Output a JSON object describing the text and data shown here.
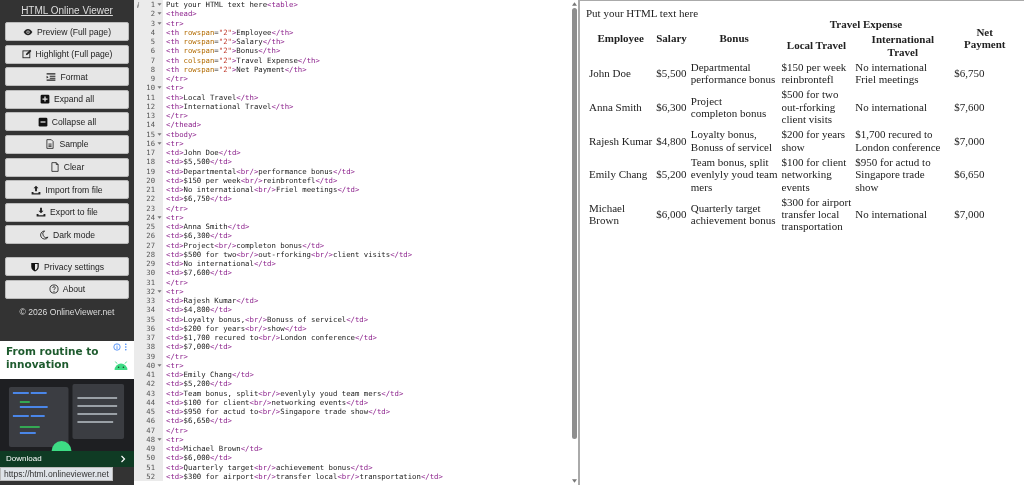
{
  "sidebar": {
    "title": "HTML Online Viewer",
    "tool_buttons": [
      "Preview (Full page)",
      "Highlight (Full page)",
      "Format",
      "Expand all",
      "Collapse all",
      "Sample",
      "Clear",
      "Import from file",
      "Export to file",
      "Dark mode"
    ],
    "settings_buttons": [
      "Privacy settings",
      "About"
    ],
    "copyright": "© 2026 OnlineViewer.net"
  },
  "ad": {
    "headline": "From routine to innovation",
    "cta": "Download"
  },
  "status_url": "https://html.onlineviewer.net",
  "editor": {
    "lines": [
      {
        "num": "1",
        "code": "Put your HTML text here<table>",
        "foldable": true,
        "annotated": true
      },
      {
        "num": "2",
        "code": "<thead>",
        "foldable": true,
        "annotated": false
      },
      {
        "num": "3",
        "code": "<tr>",
        "foldable": true,
        "annotated": false
      },
      {
        "num": "4",
        "code": "<th rowspan=\"2\">Employee</th>",
        "foldable": false,
        "annotated": false
      },
      {
        "num": "5",
        "code": "<th rowspan=\"2\">Salary</th>",
        "foldable": false,
        "annotated": false
      },
      {
        "num": "6",
        "code": "<th rowspan=\"2\">Bonus</th>",
        "foldable": false,
        "annotated": false
      },
      {
        "num": "7",
        "code": "<th colspan=\"2\">Travel Expense</th>",
        "foldable": false,
        "annotated": false
      },
      {
        "num": "8",
        "code": "<th rowspan=\"2\">Net Payment</th>",
        "foldable": false,
        "annotated": false
      },
      {
        "num": "9",
        "code": "</tr>",
        "foldable": false,
        "annotated": false
      },
      {
        "num": "10",
        "code": "<tr>",
        "foldable": true,
        "annotated": false
      },
      {
        "num": "11",
        "code": "<th>Local Travel</th>",
        "foldable": false,
        "annotated": false
      },
      {
        "num": "12",
        "code": "<th>International Travel</th>",
        "foldable": false,
        "annotated": false
      },
      {
        "num": "13",
        "code": "</tr>",
        "foldable": false,
        "annotated": false
      },
      {
        "num": "14",
        "code": "</thead>",
        "foldable": false,
        "annotated": false
      },
      {
        "num": "15",
        "code": "<tbody>",
        "foldable": true,
        "annotated": false
      },
      {
        "num": "16",
        "code": "<tr>",
        "foldable": true,
        "annotated": false
      },
      {
        "num": "17",
        "code": "<td>John Doe</td>",
        "foldable": false,
        "annotated": false
      },
      {
        "num": "18",
        "code": "<td>$5,500</td>",
        "foldable": false,
        "annotated": false
      },
      {
        "num": "19",
        "code": "<td>Departmental<br/>performance bonus</td>",
        "foldable": false,
        "annotated": false
      },
      {
        "num": "20",
        "code": "<td>$150 per week<br/>reinbrontefl</td>",
        "foldable": false,
        "annotated": false
      },
      {
        "num": "21",
        "code": "<td>No international<br/>Friel meetings</td>",
        "foldable": false,
        "annotated": false
      },
      {
        "num": "22",
        "code": "<td>$6,750</td>",
        "foldable": false,
        "annotated": false
      },
      {
        "num": "23",
        "code": "</tr>",
        "foldable": false,
        "annotated": false
      },
      {
        "num": "24",
        "code": "<tr>",
        "foldable": true,
        "annotated": false
      },
      {
        "num": "25",
        "code": "<td>Anna Smith</td>",
        "foldable": false,
        "annotated": false
      },
      {
        "num": "26",
        "code": "<td>$6,300</td>",
        "foldable": false,
        "annotated": false
      },
      {
        "num": "27",
        "code": "<td>Project<br/>completon bonus</td>",
        "foldable": false,
        "annotated": false
      },
      {
        "num": "28",
        "code": "<td>$500 for two<br/>out-rforking<br/>client visits</td>",
        "foldable": false,
        "annotated": false
      },
      {
        "num": "29",
        "code": "<td>No international</td>",
        "foldable": false,
        "annotated": false
      },
      {
        "num": "30",
        "code": "<td>$7,600</td>",
        "foldable": false,
        "annotated": false
      },
      {
        "num": "31",
        "code": "</tr>",
        "foldable": false,
        "annotated": false
      },
      {
        "num": "32",
        "code": "<tr>",
        "foldable": true,
        "annotated": false
      },
      {
        "num": "33",
        "code": "<td>Rajesh Kumar</td>",
        "foldable": false,
        "annotated": false
      },
      {
        "num": "34",
        "code": "<td>$4,800</td>",
        "foldable": false,
        "annotated": false
      },
      {
        "num": "35",
        "code": "<td>Loyalty bonus,<br/>Bonuss of servicel</td>",
        "foldable": false,
        "annotated": false
      },
      {
        "num": "36",
        "code": "<td>$200 for years<br/>show</td>",
        "foldable": false,
        "annotated": false
      },
      {
        "num": "37",
        "code": "<td>$1,700 recured to<br/>London conference</td>",
        "foldable": false,
        "annotated": false
      },
      {
        "num": "38",
        "code": "<td>$7,000</td>",
        "foldable": false,
        "annotated": false
      },
      {
        "num": "39",
        "code": "</tr>",
        "foldable": false,
        "annotated": false
      },
      {
        "num": "40",
        "code": "<tr>",
        "foldable": true,
        "annotated": false
      },
      {
        "num": "41",
        "code": "<td>Emily Chang</td>",
        "foldable": false,
        "annotated": false
      },
      {
        "num": "42",
        "code": "<td>$5,200</td>",
        "foldable": false,
        "annotated": false
      },
      {
        "num": "43",
        "code": "<td>Team bonus, split<br/>evenlyly youd team mers</td>",
        "foldable": false,
        "annotated": false
      },
      {
        "num": "44",
        "code": "<td>$100 for client<br/>networking events</td>",
        "foldable": false,
        "annotated": false
      },
      {
        "num": "45",
        "code": "<td>$950 for actud to<br/>Singapore trade show</td>",
        "foldable": false,
        "annotated": false
      },
      {
        "num": "46",
        "code": "<td>$6,650</td>",
        "foldable": false,
        "annotated": false
      },
      {
        "num": "47",
        "code": "</tr>",
        "foldable": false,
        "annotated": false
      },
      {
        "num": "48",
        "code": "<tr>",
        "foldable": true,
        "annotated": false
      },
      {
        "num": "49",
        "code": "<td>Michael Brown</td>",
        "foldable": false,
        "annotated": false
      },
      {
        "num": "50",
        "code": "<td>$6,000</td>",
        "foldable": false,
        "annotated": false
      },
      {
        "num": "51",
        "code": "<td>Quarterly target<br/>achievement bonus</td>",
        "foldable": false,
        "annotated": false
      },
      {
        "num": "52",
        "code": "<td>$300 for airport<br/>transfer local<br/>transportation</td>",
        "foldable": false,
        "annotated": false
      }
    ]
  },
  "preview": {
    "intro": "Put your HTML text here",
    "table": {
      "top_headers": [
        {
          "text": "Employee",
          "kind": "rowspan"
        },
        {
          "text": "Salary",
          "kind": "rowspan"
        },
        {
          "text": "Bonus",
          "kind": "rowspan"
        },
        {
          "text": "Travel Expense",
          "kind": "colspan"
        },
        {
          "text": "Net Payment",
          "kind": "rowspan"
        }
      ],
      "sub_headers": [
        "Local Travel",
        "International Travel"
      ],
      "rows": [
        [
          "John Doe",
          "$5,500",
          "Departmental\nperformance bonus",
          "$150 per week\nreinbrontefl",
          "No international\nFriel meetings",
          "$6,750"
        ],
        [
          "Anna Smith",
          "$6,300",
          "Project\ncompleton bonus",
          "$500 for two\nout-rforking\nclient visits",
          "No international",
          "$7,600"
        ],
        [
          "Rajesh Kumar",
          "$4,800",
          "Loyalty bonus,\nBonuss of servicel",
          "$200 for years\nshow",
          "$1,700 recured to\nLondon conference",
          "$7,000"
        ],
        [
          "Emily Chang",
          "$5,200",
          "Team bonus, split\nevenlyly youd team\nmers",
          "$100 for client\nnetworking\nevents",
          "$950 for actud to\nSingapore trade\nshow",
          "$6,650"
        ],
        [
          "Michael\nBrown",
          "$6,000",
          "Quarterly target\nachievement bonus",
          "$300 for airport\ntransfer local\ntransportation",
          "No international",
          "$7,000"
        ]
      ]
    }
  }
}
